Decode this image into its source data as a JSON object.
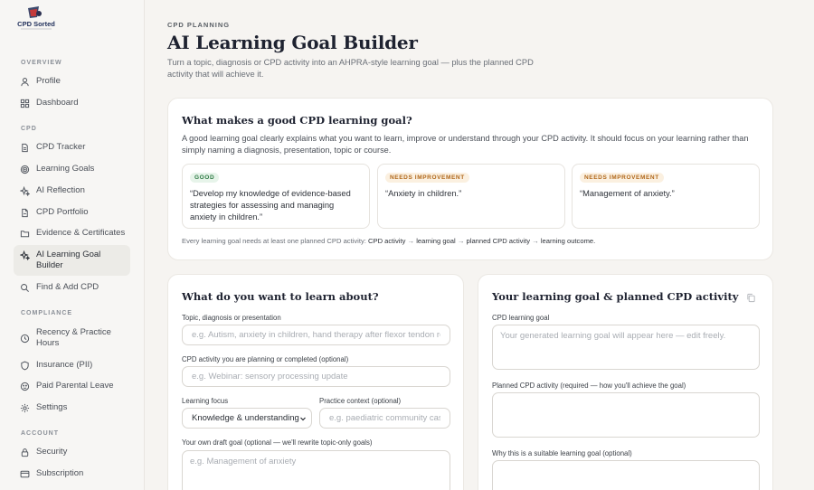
{
  "brand": {
    "name": "CPD Sorted"
  },
  "sidebar": {
    "sections": {
      "overview": "OVERVIEW",
      "cpd": "CPD",
      "compliance": "COMPLIANCE",
      "account": "ACCOUNT"
    },
    "items": [
      {
        "label": "Profile",
        "icon": "user-icon"
      },
      {
        "label": "Dashboard",
        "icon": "dashboard-icon"
      },
      {
        "label": "CPD Tracker",
        "icon": "document-icon"
      },
      {
        "label": "Learning Goals",
        "icon": "target-icon"
      },
      {
        "label": "AI Reflection",
        "icon": "sparkle-icon"
      },
      {
        "label": "CPD Portfolio",
        "icon": "file-icon"
      },
      {
        "label": "Evidence & Certificates",
        "icon": "folder-icon"
      },
      {
        "label": "AI Learning Goal Builder",
        "icon": "sparkle-icon",
        "active": true
      },
      {
        "label": "Find & Add CPD",
        "icon": "search-icon"
      },
      {
        "label": "Recency & Practice Hours",
        "icon": "clock-icon"
      },
      {
        "label": "Insurance (PII)",
        "icon": "shield-icon"
      },
      {
        "label": "Paid Parental Leave",
        "icon": "leave-icon"
      },
      {
        "label": "Settings",
        "icon": "gear-icon"
      },
      {
        "label": "Security",
        "icon": "lock-icon"
      },
      {
        "label": "Subscription",
        "icon": "card-icon"
      }
    ]
  },
  "header": {
    "eyebrow": "CPD PLANNING",
    "title": "AI Learning Goal Builder",
    "subtitle": "Turn a topic, diagnosis or CPD activity into an AHPRA-style learning goal — plus the planned CPD activity that will achieve it."
  },
  "info_card": {
    "heading": "What makes a good CPD learning goal?",
    "body": "A good learning goal clearly explains what you want to learn, improve or understand through your CPD activity. It should focus on your learning rather than simply naming a diagnosis, presentation, topic or course.",
    "examples": [
      {
        "badge": "GOOD",
        "text": "“Develop my knowledge of evidence-based strategies for assessing and managing anxiety in children.”"
      },
      {
        "badge": "NEEDS IMPROVEMENT",
        "text": "“Anxiety in children.”"
      },
      {
        "badge": "NEEDS IMPROVEMENT",
        "text": "“Management of anxiety.”"
      }
    ],
    "flow_prefix": "Every learning goal needs at least one planned CPD activity:",
    "flow": [
      "CPD activity",
      "learning goal",
      "planned CPD activity",
      "learning outcome."
    ]
  },
  "form": {
    "heading": "What do you want to learn about?",
    "topic_label": "Topic, diagnosis or presentation",
    "topic_placeholder": "e.g. Autism, anxiety in children, hand therapy after flexor tendon repair",
    "activity_label": "CPD activity you are planning or completed (optional)",
    "activity_placeholder": "e.g. Webinar: sensory processing update",
    "focus_label": "Learning focus",
    "focus_value": "Knowledge & understanding",
    "context_label": "Practice context (optional)",
    "context_placeholder": "e.g. paediatric community case",
    "draft_label": "Your own draft goal (optional — we'll rewrite topic-only goals)",
    "draft_placeholder": "e.g. Management of anxiety"
  },
  "output": {
    "heading": "Your learning goal & planned CPD activity",
    "goal_label": "CPD learning goal",
    "goal_placeholder": "Your generated learning goal will appear here — edit freely.",
    "planned_label": "Planned CPD activity (required — how you'll achieve the goal)",
    "why_label": "Why this is a suitable learning goal (optional)"
  }
}
